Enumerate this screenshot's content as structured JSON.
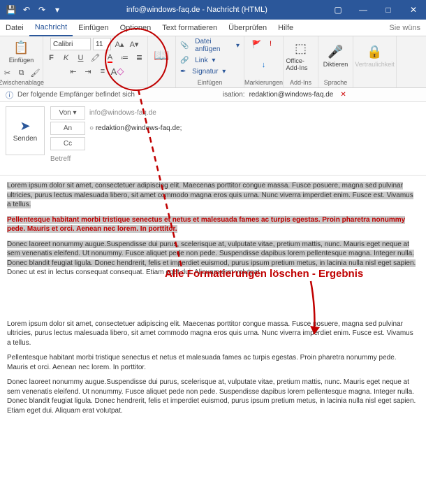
{
  "title": "info@windows-faq.de - Nachricht (HTML)",
  "menubar": {
    "tabs": [
      "Datei",
      "Nachricht",
      "Einfügen",
      "Optionen",
      "Text formatieren",
      "Überprüfen",
      "Hilfe"
    ],
    "active": 1,
    "tell_me": "Sie wüns"
  },
  "ribbon": {
    "paste": "Einfügen",
    "g_clipboard": "Zwischenablage",
    "font_name": "Calibri",
    "font_size": "11",
    "attach_file": "Datei anfügen",
    "link": "Link",
    "signature": "Signatur",
    "g_include": "Einfügen",
    "g_tags": "Markierungen",
    "addins": "Office-Add-Ins",
    "g_addins": "Add-Ins",
    "dictate": "Diktieren",
    "g_speech": "Sprache",
    "sensitivity": "Vertraulichkeit"
  },
  "external": {
    "prefix": "Der folgende Empfänger befindet sich",
    "suffix": "isation:",
    "recipient": "redaktion@windows-faq.de"
  },
  "compose": {
    "send": "Senden",
    "from_label": "Von",
    "from_value": "info@windows-faq.de",
    "to_label": "An",
    "to_value": "redaktion@windows-faq.de;",
    "cc_label": "Cc",
    "subject_label": "Betreff"
  },
  "body": {
    "p1": "Lorem ipsum dolor sit amet, consectetuer adipiscing elit. Maecenas porttitor congue massa. Fusce posuere, magna sed pulvinar ultricies, purus lectus malesuada libero, sit amet commodo magna eros quis urna. Nunc viverra imperdiet enim. Fusce est. Vivamus a tellus.",
    "p2": "Pellentesque habitant morbi tristique senectus et netus et malesuada fames ac turpis egestas. Proin pharetra nonummy pede. Mauris et orci. Aenean nec lorem. In porttitor.",
    "p3": "Donec laoreet nonummy augue.Suspendisse dui purus, scelerisque at, vulputate vitae, pretium mattis, nunc. Mauris eget neque at sem venenatis eleifend. Ut nonummy. Fusce aliquet pede non pede. Suspendisse dapibus lorem pellentesque magna. Integer nulla. Donec blandit feugiat ligula. Donec hendrerit, felis et imperdiet euismod, purus ipsum pretium metus, in lacinia nulla nisl eget sapien.",
    "p3b": "Donec ut est in lectus consequat consequat. Etiam eget dui. Aliquam erat volutpat.",
    "p4": "Lorem ipsum dolor sit amet, consectetuer adipiscing elit. Maecenas porttitor congue massa. Fusce posuere, magna sed pulvinar ultricies, purus lectus malesuada libero, sit amet commodo magna eros quis urna. Nunc viverra imperdiet enim. Fusce est. Vivamus a tellus.",
    "p5": "Pellentesque habitant morbi tristique senectus et netus et malesuada fames ac turpis egestas. Proin pharetra nonummy pede. Mauris et orci. Aenean nec lorem. In porttitor.",
    "p6": "Donec laoreet nonummy augue.Suspendisse dui purus, scelerisque at, vulputate vitae, pretium mattis, nunc. Mauris eget neque at sem venenatis eleifend. Ut nonummy. Fusce aliquet pede non pede. Suspendisse dapibus lorem pellentesque magna. Integer nulla. Donec blandit feugiat ligula. Donec hendrerit, felis et imperdiet euismod, purus ipsum pretium metus, in lacinia nulla nisl eget sapien. Etiam eget dui. Aliquam erat volutpat."
  },
  "annotation": "Alle Formatierungen löschen - Ergebnis"
}
